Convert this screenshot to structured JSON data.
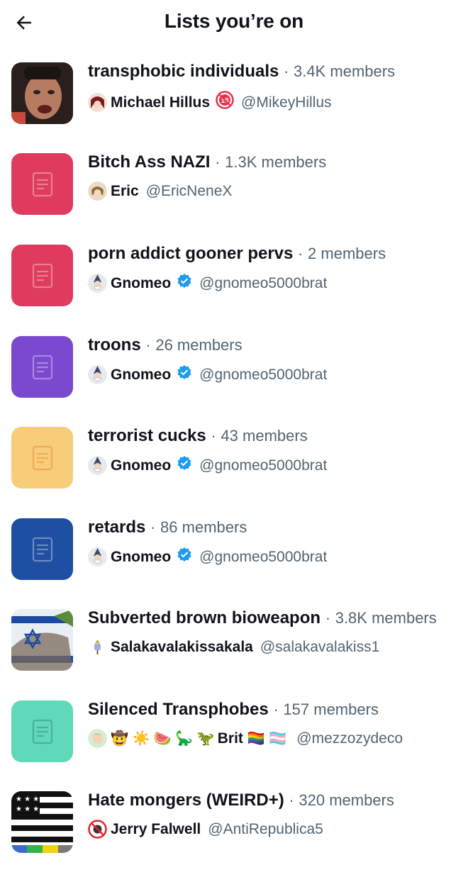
{
  "header": {
    "title": "Lists you’re on",
    "back_icon": "back-arrow-icon"
  },
  "lists": [
    {
      "name": "transphobic individuals",
      "separator": "·",
      "members": "3.4K members",
      "owner": "Michael Hillus",
      "handle": "@MikeyHillus",
      "owner_badge": "18",
      "color": "#3a2a25"
    },
    {
      "name": "Bitch Ass NAZI",
      "separator": "·",
      "members": "1.3K members",
      "owner": "Eric",
      "handle": "@EricNeneX",
      "color": "#de3b5f"
    },
    {
      "name": "porn addict gooner pervs",
      "separator": "·",
      "members": "2 members",
      "owner": "Gnomeo",
      "handle": "@gnomeo5000brat",
      "verified": true,
      "color": "#de3b5f"
    },
    {
      "name": "troons",
      "separator": "·",
      "members": "26 members",
      "owner": "Gnomeo",
      "handle": "@gnomeo5000brat",
      "verified": true,
      "color": "#7b49cf"
    },
    {
      "name": "terrorist cucks",
      "separator": "·",
      "members": "43 members",
      "owner": "Gnomeo",
      "handle": "@gnomeo5000brat",
      "verified": true,
      "color": "#f8cd7a"
    },
    {
      "name": "retards",
      "separator": "·",
      "members": "86 members",
      "owner": "Gnomeo",
      "handle": "@gnomeo5000brat",
      "verified": true,
      "color": "#1e4fa2"
    },
    {
      "name": "Subverted brown bioweapon",
      "separator": "·",
      "members": "3.8K members",
      "owner": "Salakavalakissakala",
      "handle": "@salakavalakiss1",
      "color": "#3a62a8"
    },
    {
      "name": "Silenced Transphobes",
      "separator": "·",
      "members": "157 members",
      "owner": "Brit",
      "owner_emoji_prefix": "🤠 ☀️ 🍉 🦕 🦖",
      "owner_emoji_suffix": "🏳️‍🌈 🏳️‍⚧️",
      "handle": "@mezzozydeco",
      "color": "#5fd9b7"
    },
    {
      "name": "Hate mongers (WEIRD+)",
      "separator": "·",
      "members": "320 members",
      "owner": "Jerry Falwell",
      "handle": "@AntiRepublica5",
      "color": "#111111"
    }
  ],
  "colors": {
    "text": "#0f1419",
    "muted": "#536471",
    "verified": "#1d9bf0"
  }
}
